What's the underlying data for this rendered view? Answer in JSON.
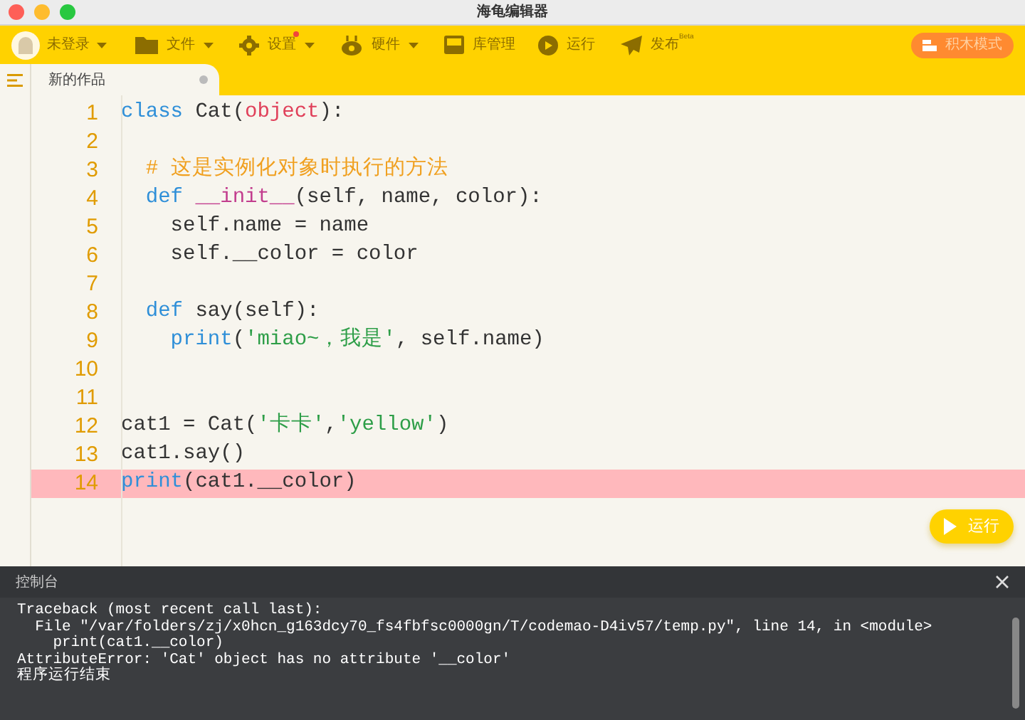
{
  "window": {
    "title": "海龟编辑器"
  },
  "toolbar": {
    "user": {
      "label": "未登录",
      "dropdown": true
    },
    "items": [
      {
        "kind": "folder",
        "label": "文件",
        "dropdown": true,
        "notified": false
      },
      {
        "kind": "gear",
        "label": "设置",
        "dropdown": true,
        "notified": true
      },
      {
        "kind": "hardware",
        "label": "硬件",
        "dropdown": true,
        "notified": false
      },
      {
        "kind": "library",
        "label": "库管理",
        "dropdown": false,
        "notified": false
      },
      {
        "kind": "run",
        "label": "运行",
        "dropdown": false,
        "notified": false
      },
      {
        "kind": "publish",
        "label": "发布",
        "sup": "Beta",
        "dropdown": false,
        "notified": false
      }
    ],
    "mode_button": {
      "label": "积木模式"
    }
  },
  "tabs": [
    {
      "label": "新的作品",
      "selected": true,
      "unsaved": true
    }
  ],
  "code_lines": [
    {
      "number": "1",
      "error": false,
      "tokens": [
        {
          "kind": "keyword",
          "text": "class"
        },
        {
          "kind": "plain",
          "text": " Cat("
        },
        {
          "kind": "builtin",
          "text": "object"
        },
        {
          "kind": "plain",
          "text": "):"
        }
      ]
    },
    {
      "number": "2",
      "error": false
    },
    {
      "number": "3",
      "error": false,
      "tokens": [
        {
          "kind": "comment",
          "text": "  # 这是实例化对象时执行的方法"
        }
      ]
    },
    {
      "number": "4",
      "error": false,
      "tokens": [
        {
          "kind": "keyword",
          "text": "  def"
        },
        {
          "kind": "magic",
          "text": " __init__"
        },
        {
          "kind": "plain",
          "text": "(self, name, color):"
        }
      ]
    },
    {
      "number": "5",
      "error": false,
      "tokens": [
        {
          "kind": "plain",
          "text": "    self.name = name"
        }
      ]
    },
    {
      "number": "6",
      "error": false,
      "tokens": [
        {
          "kind": "plain",
          "text": "    self.__color = color"
        }
      ]
    },
    {
      "number": "7",
      "error": false
    },
    {
      "number": "8",
      "error": false,
      "tokens": [
        {
          "kind": "keyword",
          "text": "  def"
        },
        {
          "kind": "plain",
          "text": " say(self):"
        }
      ]
    },
    {
      "number": "9",
      "error": false,
      "tokens": [
        {
          "kind": "keyword",
          "text": "    print"
        },
        {
          "kind": "plain",
          "text": "("
        },
        {
          "kind": "string",
          "text": "'miao~，我是'"
        },
        {
          "kind": "plain",
          "text": ", self.name)"
        }
      ]
    },
    {
      "number": "10",
      "error": false
    },
    {
      "number": "11",
      "error": false
    },
    {
      "number": "12",
      "error": false,
      "tokens": [
        {
          "kind": "plain",
          "text": "cat1 = Cat("
        },
        {
          "kind": "string",
          "text": "'卡卡'"
        },
        {
          "kind": "plain",
          "text": ","
        },
        {
          "kind": "string",
          "text": "'yellow'"
        },
        {
          "kind": "plain",
          "text": ")"
        }
      ]
    },
    {
      "number": "13",
      "error": false,
      "tokens": [
        {
          "kind": "plain",
          "text": "cat1.say()"
        }
      ]
    },
    {
      "number": "14",
      "error": true,
      "tokens": [
        {
          "kind": "keyword",
          "text": "print"
        },
        {
          "kind": "plain",
          "text": "(cat1.__color)"
        }
      ]
    }
  ],
  "run_button": {
    "label": "运行"
  },
  "console": {
    "title": "控制台",
    "output": [
      "Traceback (most recent call last):",
      "  File \"/var/folders/zj/x0hcn_g163dcy70_fs4fbfsc0000gn/T/codemao-D4iv57/temp.py\", line 14, in <module>",
      "    print(cat1.__color)",
      "AttributeError: 'Cat' object has no attribute '__color'",
      "程序运行结束"
    ]
  }
}
